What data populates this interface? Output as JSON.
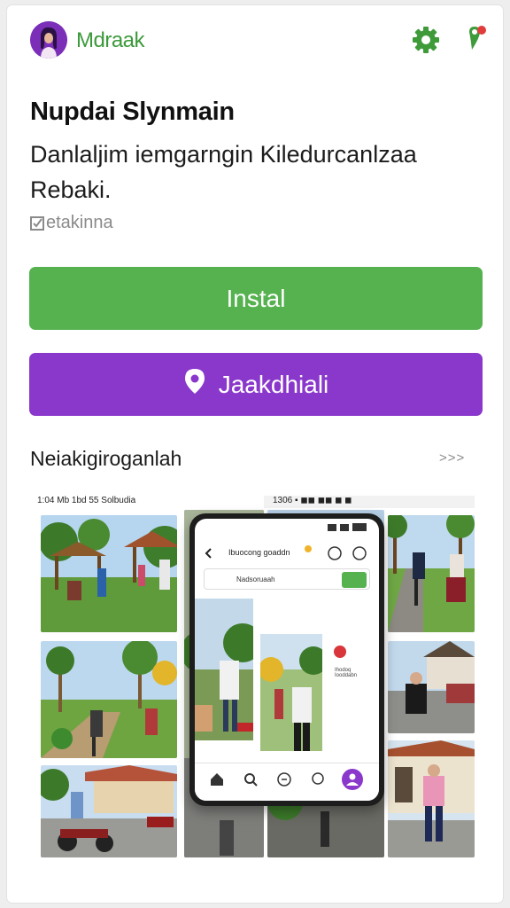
{
  "header": {
    "brand": "Mdraak",
    "avatar_icon": "user-avatar-icon",
    "settings_icon": "gear-icon",
    "location_icon": "map-pin-icon",
    "accent_green": "#55b24f",
    "accent_purple": "#8a37cb"
  },
  "app": {
    "title": "Nupdai Slynmain",
    "description": "Danlaljim iemgarngin Kiledurcanlzaa Rebaki.",
    "tag": "etakinna"
  },
  "buttons": {
    "install": "Instal",
    "location": "Jaakdhiali",
    "location_icon": "location-pin-icon"
  },
  "screenshots": {
    "title": "Neiakigiroganlah",
    "more": ">>>",
    "strip_left": "1:04  Mb  1bd 55 Solbudia",
    "strip_right": "1306  ▪  ◼◼  ◼◼  ◼ ◼",
    "phone_search": "Ibuocong goaddn",
    "phone_field": "Nadsoruaah",
    "phone_caption": "Ihodoq\nIooddabn"
  }
}
